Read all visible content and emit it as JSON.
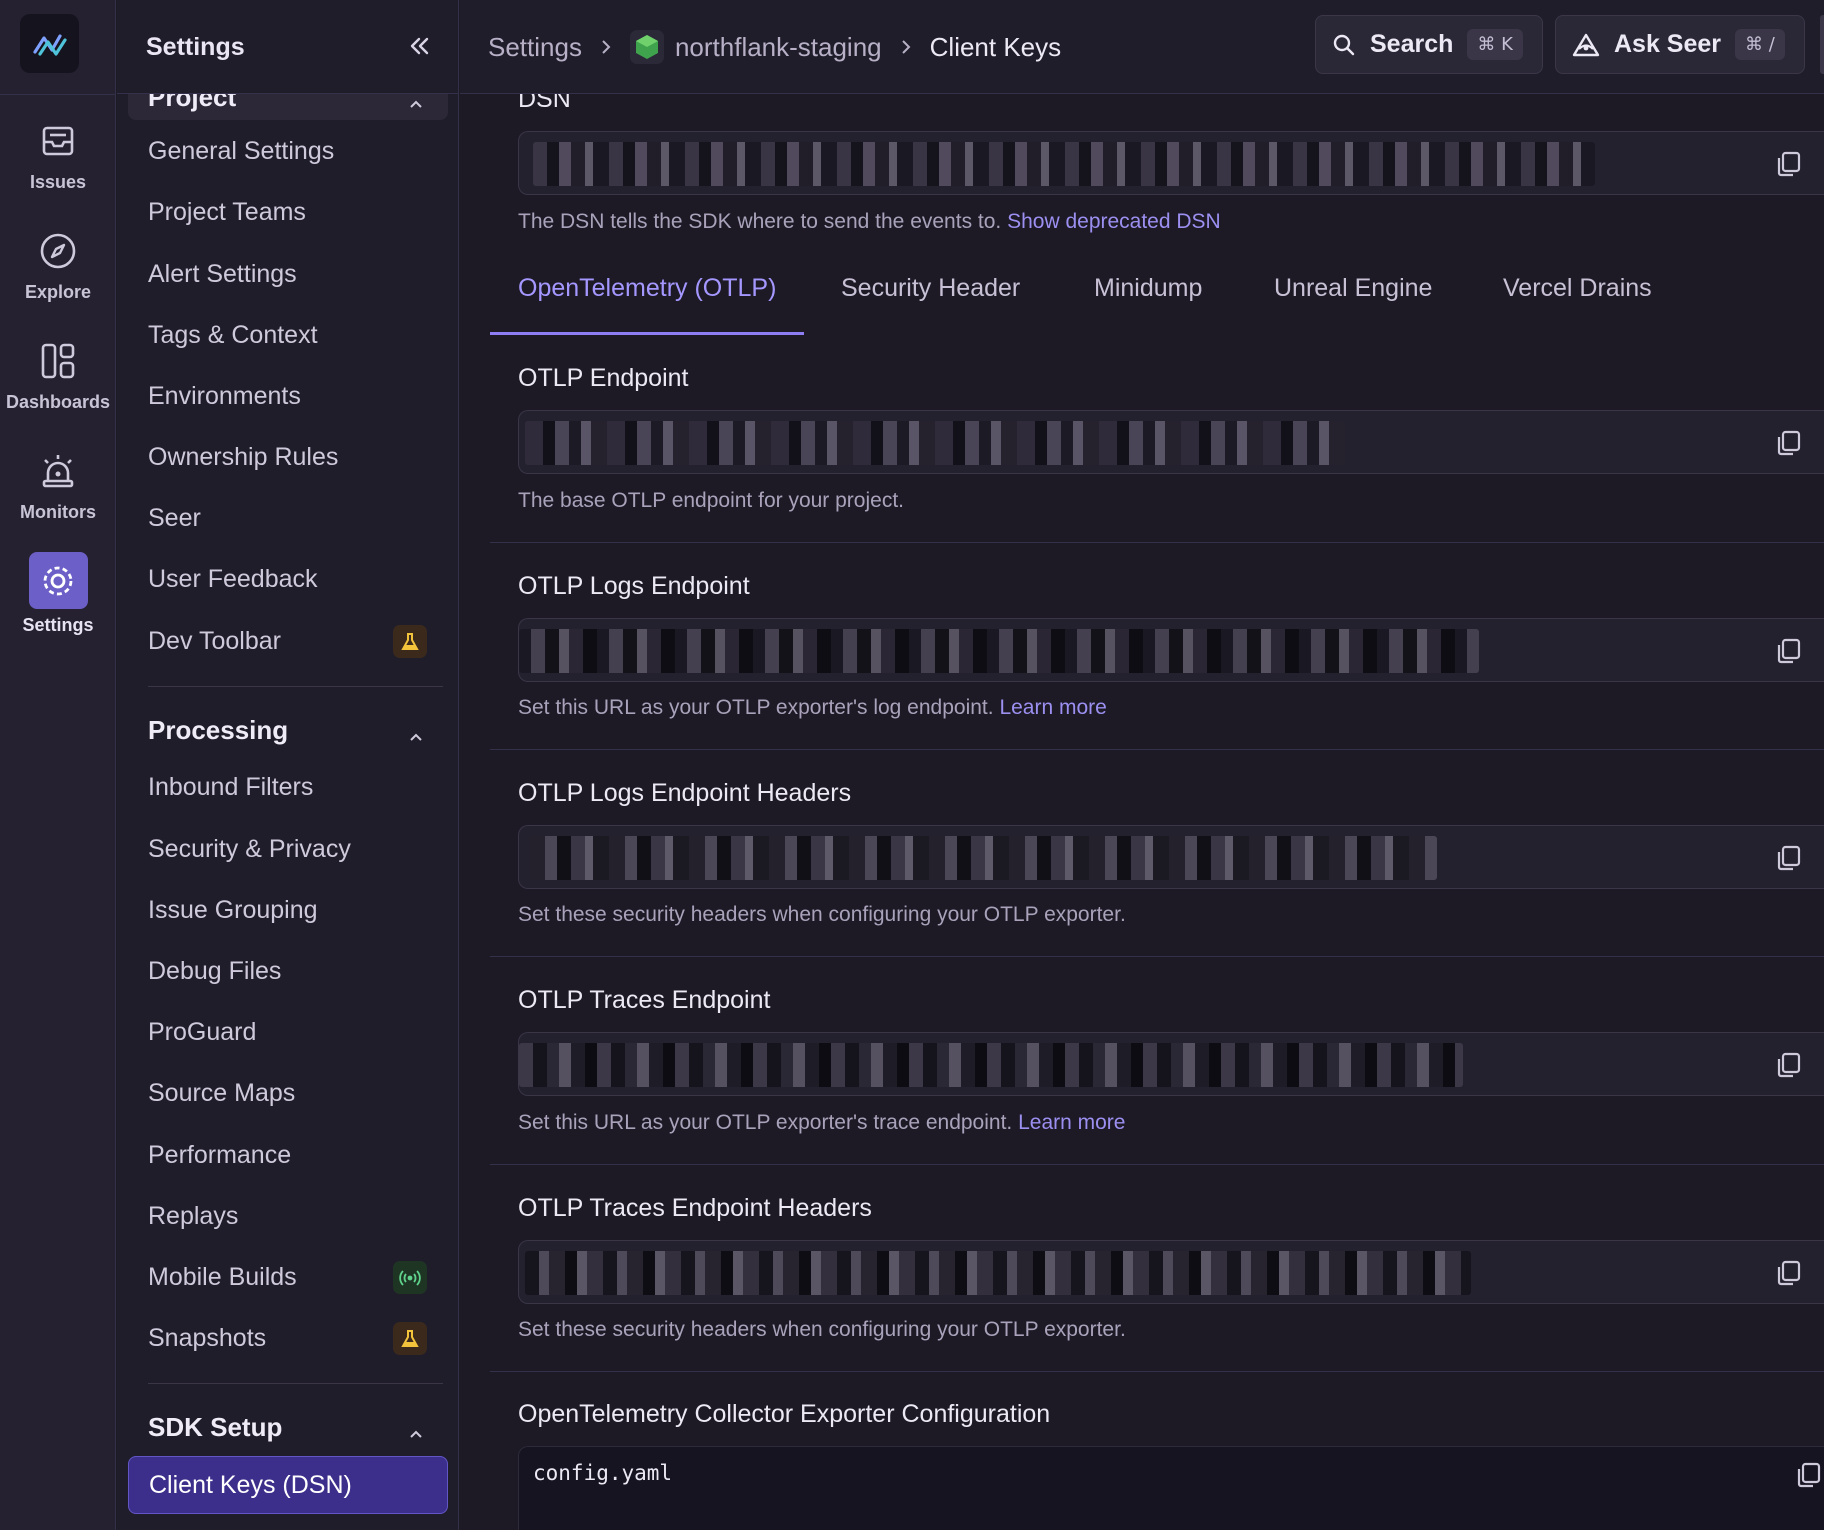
{
  "rail": {
    "items": [
      {
        "label": "Issues",
        "icon": "inbox-icon"
      },
      {
        "label": "Explore",
        "icon": "compass-icon"
      },
      {
        "label": "Dashboards",
        "icon": "dashboard-icon"
      },
      {
        "label": "Monitors",
        "icon": "siren-icon"
      },
      {
        "label": "Settings",
        "icon": "gear-icon",
        "active": true
      }
    ]
  },
  "sidebar": {
    "title": "Settings",
    "project_section": "Project",
    "project_links": [
      "General Settings",
      "Project Teams",
      "Alert Settings",
      "Tags & Context",
      "Environments",
      "Ownership Rules",
      "Seer",
      "User Feedback",
      "Dev Toolbar"
    ],
    "processing_section": "Processing",
    "processing_links": [
      "Inbound Filters",
      "Security & Privacy",
      "Issue Grouping",
      "Debug Files",
      "ProGuard",
      "Source Maps",
      "Performance",
      "Replays",
      "Mobile Builds",
      "Snapshots"
    ],
    "sdk_section": "SDK Setup",
    "sdk_links": [
      "Client Keys (DSN)"
    ]
  },
  "breadcrumb": {
    "root": "Settings",
    "project": "northflank-staging",
    "current": "Client Keys"
  },
  "topbar": {
    "search_label": "Search",
    "search_kbd": "⌘ K",
    "seer_label": "Ask Seer",
    "seer_kbd": "⌘ /"
  },
  "dsn": {
    "label": "DSN",
    "help": "The DSN tells the SDK where to send the events to.",
    "help_link": "Show deprecated DSN"
  },
  "tabs": [
    "OpenTelemetry (OTLP)",
    "Security Header",
    "Minidump",
    "Unreal Engine",
    "Vercel Drains"
  ],
  "fields": [
    {
      "label": "OTLP Endpoint",
      "help": "The base OTLP endpoint for your project.",
      "link": ""
    },
    {
      "label": "OTLP Logs Endpoint",
      "help": "Set this URL as your OTLP exporter's log endpoint.",
      "link": "Learn more"
    },
    {
      "label": "OTLP Logs Endpoint Headers",
      "help": "Set these security headers when configuring your OTLP exporter.",
      "link": ""
    },
    {
      "label": "OTLP Traces Endpoint",
      "help": "Set this URL as your OTLP exporter's trace endpoint.",
      "link": "Learn more"
    },
    {
      "label": "OTLP Traces Endpoint Headers",
      "help": "Set these security headers when configuring your OTLP exporter.",
      "link": ""
    }
  ],
  "collector": {
    "label": "OpenTelemetry Collector Exporter Configuration",
    "filename": "config.yaml"
  },
  "colors": {
    "accent": "#6c5fc7",
    "link": "#9b8ff0",
    "tab_active": "#a497ff"
  }
}
